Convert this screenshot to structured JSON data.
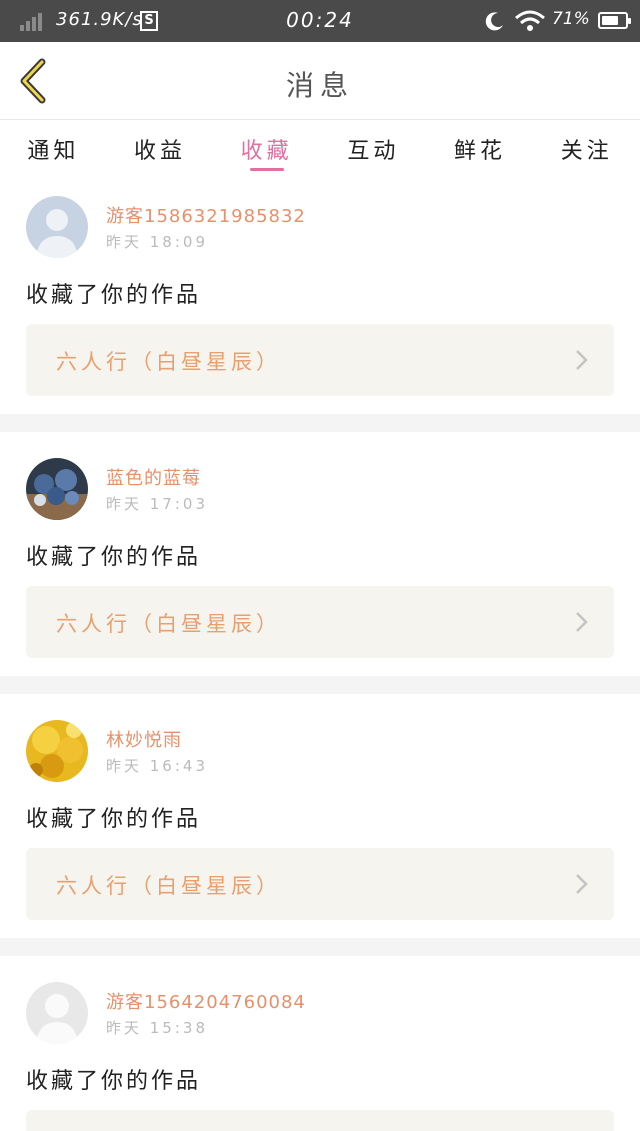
{
  "status_bar": {
    "speed": "361.9K/s",
    "s_icon": "S",
    "time": "00:24",
    "battery": "71%",
    "battery_level": 0.71
  },
  "header": {
    "title": "消息",
    "back_icon": "chevron-left-icon"
  },
  "tabs": [
    {
      "label": "通知",
      "active": false
    },
    {
      "label": "收益",
      "active": false
    },
    {
      "label": "收藏",
      "active": true
    },
    {
      "label": "互动",
      "active": false
    },
    {
      "label": "鲜花",
      "active": false
    },
    {
      "label": "关注",
      "active": false
    }
  ],
  "colors": {
    "accent_pink": "#e0709e",
    "username_orange": "#e8906a",
    "work_title_orange": "#e8a070",
    "work_box_bg": "#f5f4ee"
  },
  "messages": [
    {
      "username": "游客1586321985832",
      "time": "昨天 18:09",
      "action": "收藏了你的作品",
      "work_title": "六人行（白昼星辰）",
      "avatar": "default-guest-avatar-blue"
    },
    {
      "username": "蓝色的蓝莓",
      "time": "昨天 17:03",
      "action": "收藏了你的作品",
      "work_title": "六人行（白昼星辰）",
      "avatar": "blueberry-photo-avatar"
    },
    {
      "username": "林妙悦雨",
      "time": "昨天 16:43",
      "action": "收藏了你的作品",
      "work_title": "六人行（白昼星辰）",
      "avatar": "yellow-flower-photo-avatar"
    },
    {
      "username": "游客1564204760084",
      "time": "昨天 15:38",
      "action": "收藏了你的作品",
      "work_title": "",
      "avatar": "default-guest-avatar-gray"
    }
  ]
}
